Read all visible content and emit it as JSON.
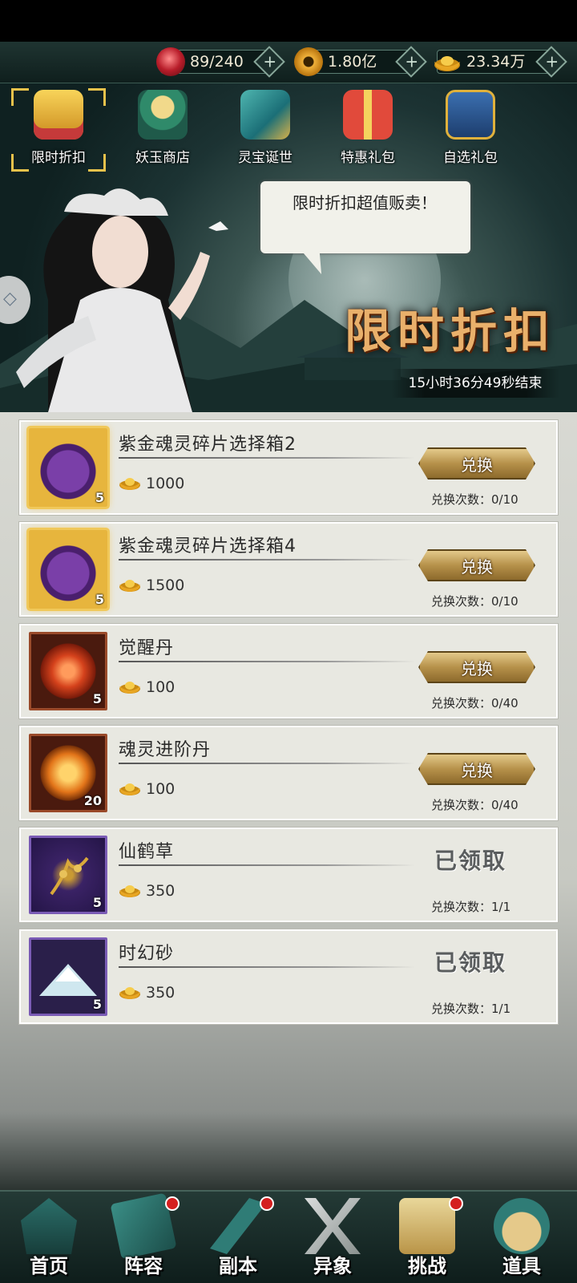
{
  "resources": {
    "stamina": {
      "value": "89/240",
      "icon": "stamina-gem-icon"
    },
    "coins": {
      "value": "1.80亿",
      "icon": "coin-icon"
    },
    "ingots": {
      "value": "23.34万",
      "icon": "gold-ingot-icon"
    }
  },
  "tabs": [
    {
      "label": "限时折扣",
      "icon": "discount-gift-icon",
      "active": true
    },
    {
      "label": "妖玉商店",
      "icon": "jade-shop-icon",
      "active": false
    },
    {
      "label": "灵宝诞世",
      "icon": "treasure-icon",
      "active": false
    },
    {
      "label": "特惠礼包",
      "icon": "gift-box-icon",
      "active": false
    },
    {
      "label": "自选礼包",
      "icon": "chest-icon",
      "active": false
    }
  ],
  "banner": {
    "speech": "限时折扣超值贩卖！",
    "title": "限时折扣",
    "timer": "15小时36分49秒结束"
  },
  "items": [
    {
      "name": "紫金魂灵碎片选择箱2",
      "count": "5",
      "price": "1000",
      "button": "兑换",
      "limit": "兑换次数：0/10",
      "claimed": false
    },
    {
      "name": "紫金魂灵碎片选择箱4",
      "count": "5",
      "price": "1500",
      "button": "兑换",
      "limit": "兑换次数：0/10",
      "claimed": false
    },
    {
      "name": "觉醒丹",
      "count": "5",
      "price": "100",
      "button": "兑换",
      "limit": "兑换次数：0/40",
      "claimed": false
    },
    {
      "name": "魂灵进阶丹",
      "count": "20",
      "price": "100",
      "button": "兑换",
      "limit": "兑换次数：0/40",
      "claimed": false
    },
    {
      "name": "仙鹤草",
      "count": "5",
      "price": "350",
      "claimed_label": "已领取",
      "limit": "兑换次数：1/1",
      "claimed": true
    },
    {
      "name": "时幻砂",
      "count": "5",
      "price": "350",
      "claimed_label": "已领取",
      "limit": "兑换次数：1/1",
      "claimed": true
    }
  ],
  "nav": [
    {
      "label": "首页",
      "icon": "home-pavilion-icon",
      "badge": false
    },
    {
      "label": "阵容",
      "icon": "lineup-book-icon",
      "badge": true
    },
    {
      "label": "副本",
      "icon": "sword-icon",
      "badge": true
    },
    {
      "label": "异象",
      "icon": "crossed-swords-icon",
      "badge": false
    },
    {
      "label": "挑战",
      "icon": "scroll-icon",
      "badge": true
    },
    {
      "label": "道具",
      "icon": "bag-icon",
      "badge": false
    }
  ],
  "colors": {
    "accent_gold": "#e9c24b",
    "badge_red": "#d41f1f",
    "title_orange": "#e9b06b"
  }
}
